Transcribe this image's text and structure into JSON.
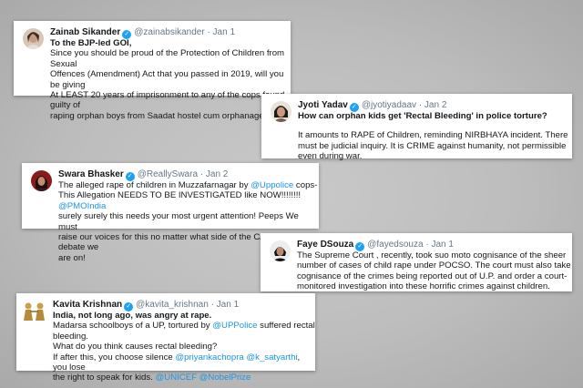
{
  "tweets": [
    {
      "name": "Zainab Sikander",
      "handle": "@zainabsikander",
      "date": "· Jan 1",
      "lines": [
        "To the BJP-led GOI,",
        "Since you should be proud of the Protection of Children from Sexual",
        "Offences (Amendment) Act that you passed in 2019, will you be giving",
        "At LEAST 20 years of imprisonment to any of the cops found guilty of",
        "raping orphan boys from Saadat hostel cum orphanage?"
      ]
    },
    {
      "name": "Jyoti Yadav",
      "handle": "@jyotiyadaav",
      "date": "· Jan 2",
      "lines": [
        "How can orphan kids get 'Rectal Bleeding' in police torture?",
        "",
        "It amounts to RAPE of Children, reminding NIRBHAYA incident. There",
        "must be judicial inquiry. It is CRIME against humanity, not permissible",
        "even during war."
      ]
    },
    {
      "name": "Swara Bhasker",
      "handle": "@ReallySwara",
      "date": "· Jan 2",
      "lines": [
        "The alleged rape of children in Muzzafarnagar by @Uppolice cops-",
        "This Allegation NEEDS TO BE INVESTIGATED like NOW!!!!!!!! @PMOIndia",
        "surely surely this needs your most urgent attention! Peeps We must",
        "raise our voices for this no matter what side of the CAA-NRC debate we",
        "are on!"
      ]
    },
    {
      "name": "Faye DSouza",
      "handle": "@fayedsouza",
      "date": "· Jan 1",
      "lines": [
        "The Supreme Court , recently, took suo moto cognisance of the sheer",
        "number of cases of child rape under POCSO. The court must also take",
        "cognisance of the crimes being reported out of U.P. and order a court-",
        "monitored investigation into these horrific crimes against children."
      ]
    },
    {
      "name": "Kavita Krishnan",
      "handle": "@kavita_krishnan",
      "date": "· Jan 1",
      "lines": [
        "India, not long ago, was angry at rape.",
        "Madarsa schoolboys of a UP, tortured by @UPPolice suffered rectal",
        "bleeding.",
        "What do you think causes rectal bleeding?",
        "If after this, you choose silence @priyankachopra @k_satyarthi, you lose",
        "the right to speak for kids. @UNICEF @NobelPrize"
      ]
    }
  ],
  "verified_badge": "✓",
  "colors": {
    "link": "#1b95e0",
    "verified": "#1da1f2",
    "secondary": "#657786"
  }
}
